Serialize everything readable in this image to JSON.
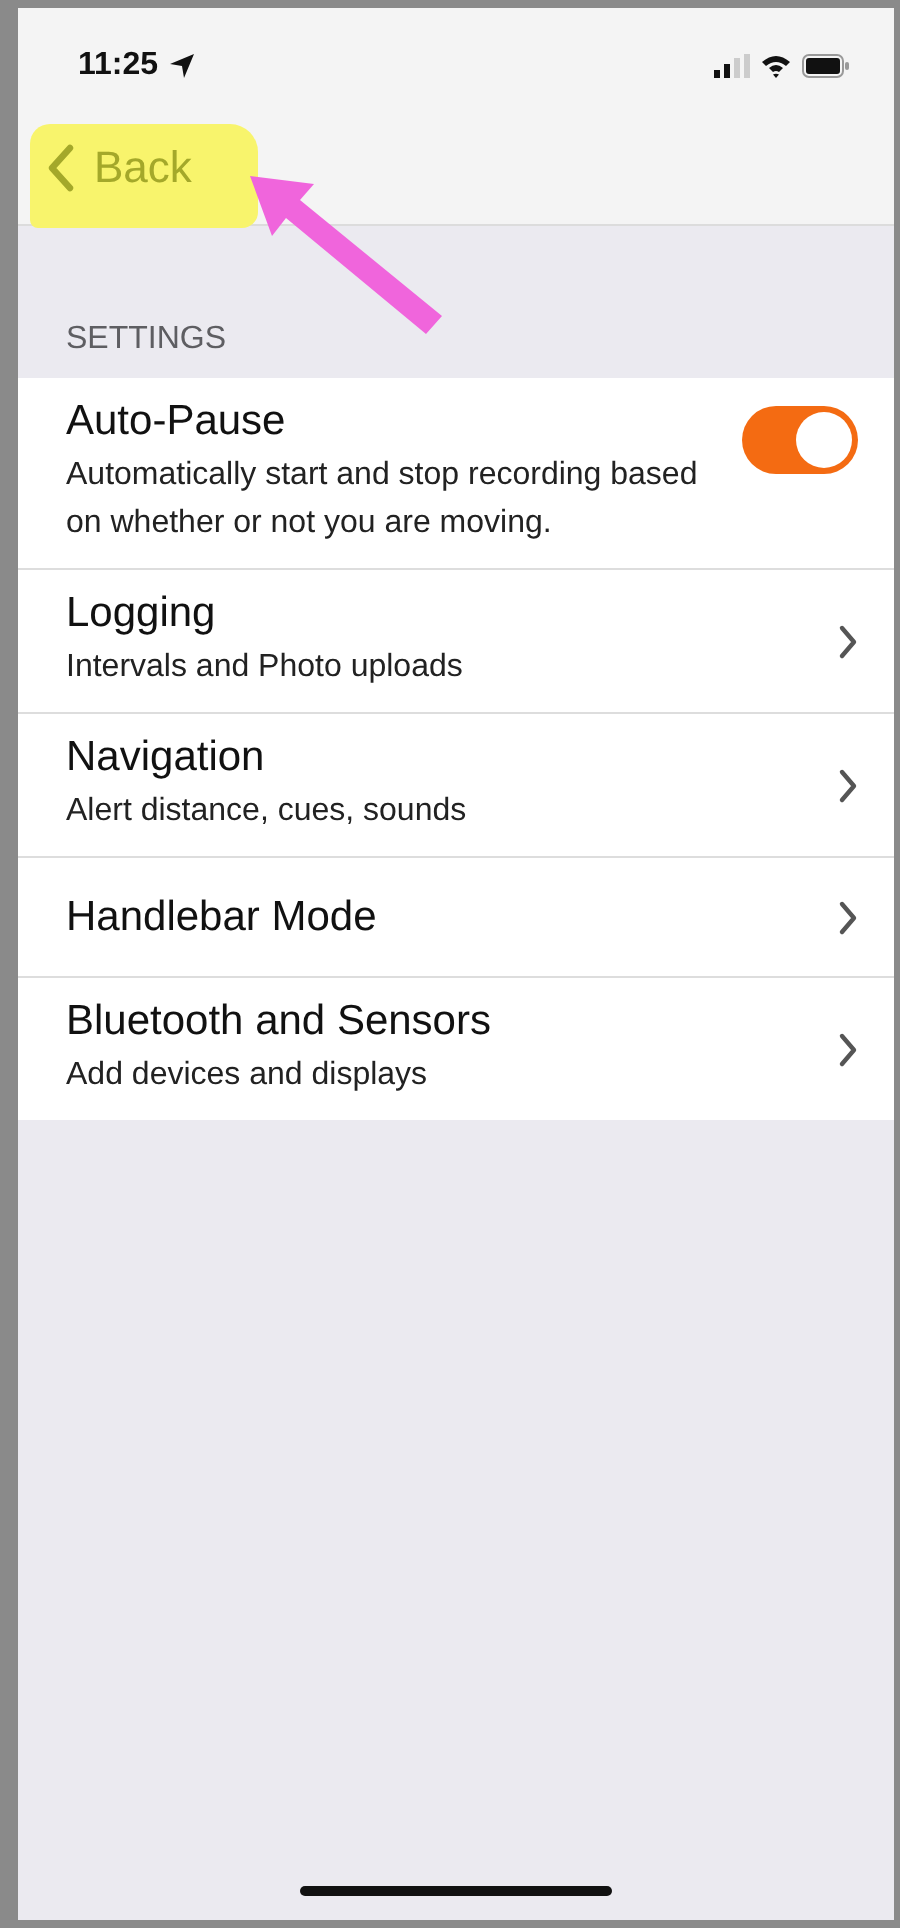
{
  "status_bar": {
    "time": "11:25"
  },
  "nav_bar": {
    "back_label": "Back"
  },
  "section": {
    "header": "SETTINGS"
  },
  "items": [
    {
      "kind": "toggle",
      "title": "Auto-Pause",
      "subtitle": "Automatically start and stop recording based on whether or not you are moving.",
      "on": true
    },
    {
      "kind": "link",
      "title": "Logging",
      "subtitle": "Intervals and Photo uploads"
    },
    {
      "kind": "link",
      "title": "Navigation",
      "subtitle": "Alert distance, cues, sounds"
    },
    {
      "kind": "link",
      "title": "Handlebar Mode"
    },
    {
      "kind": "link",
      "title": "Bluetooth and Sensors",
      "subtitle": "Add devices and displays"
    }
  ]
}
